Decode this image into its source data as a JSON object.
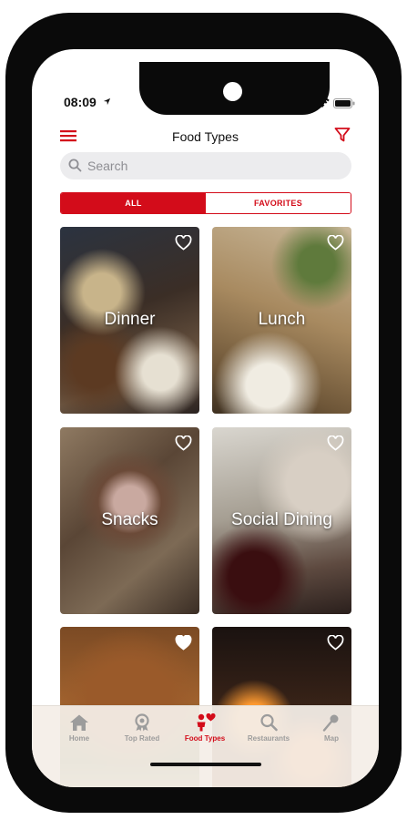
{
  "status_bar": {
    "time": "08:09"
  },
  "nav": {
    "title": "Food Types"
  },
  "search": {
    "placeholder": "Search"
  },
  "segments": {
    "all": "ALL",
    "favorites": "FAVORITES",
    "selected": "ALL"
  },
  "cards": [
    {
      "label": "Dinner",
      "favorited": false
    },
    {
      "label": "Lunch",
      "favorited": false
    },
    {
      "label": "Snacks",
      "favorited": false
    },
    {
      "label": "Social Dining",
      "favorited": false
    },
    {
      "label": "",
      "favorited": true
    },
    {
      "label": "",
      "favorited": false
    }
  ],
  "tabs": [
    {
      "label": "Home",
      "icon": "home-icon"
    },
    {
      "label": "Top Rated",
      "icon": "award-icon"
    },
    {
      "label": "Food Types",
      "icon": "food-types-icon",
      "active": true
    },
    {
      "label": "Restaurants",
      "icon": "search-icon"
    },
    {
      "label": "Map",
      "icon": "map-pin-icon"
    }
  ],
  "colors": {
    "accent": "#d30c1a",
    "tab_inactive": "#9c9c9c"
  }
}
